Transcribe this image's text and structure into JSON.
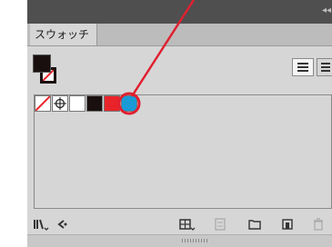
{
  "panel": {
    "collapse_glyph": "◂◂",
    "tab_label": "スウォッチ"
  },
  "swatches": [
    {
      "name": "none-swatch",
      "color": "#ffffff",
      "icon": "none-slash-icon"
    },
    {
      "name": "registration-swatch",
      "color": "#ffffff",
      "icon": "registration-target-icon"
    },
    {
      "name": "white-swatch",
      "color": "#ffffff"
    },
    {
      "name": "black-swatch",
      "color": "#1a0f0f"
    },
    {
      "name": "red-swatch",
      "color": "#e8242a"
    },
    {
      "name": "cyan-swatch",
      "color": "#1a9ad6",
      "highlighted": true
    }
  ],
  "icons": {
    "fill_stroke": "fill-stroke-indicator-icon",
    "list_view": "list-view-icon",
    "thumbnail_view": "thumbnail-view-icon",
    "library": "swatch-libraries-menu-icon",
    "show_kinds": "show-swatch-kinds-icon",
    "options": "swatch-options-icon",
    "color_group": "new-color-group-icon",
    "new_swatch": "new-swatch-icon",
    "delete": "delete-swatch-icon"
  },
  "colors": {
    "panel_bg": "#d6d6d6",
    "titlebar": "#4f4f4f",
    "callout": "#e02030",
    "highlight": "#1a9ad6"
  }
}
